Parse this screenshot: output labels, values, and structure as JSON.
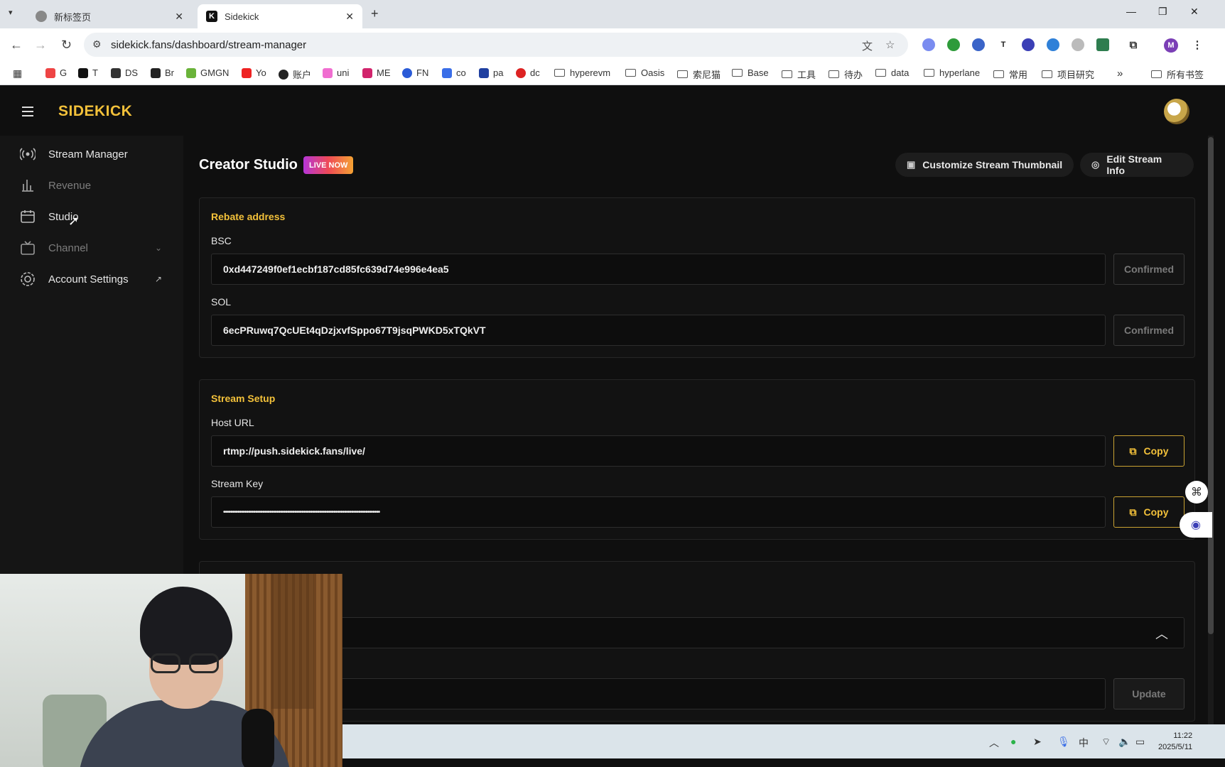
{
  "browser": {
    "tabs": [
      {
        "label": "新标签页",
        "active": false
      },
      {
        "label": "Sidekick",
        "active": true
      }
    ],
    "url": "sidekick.fans/dashboard/stream-manager",
    "profile_initial": "M",
    "bookmarks": [
      "G",
      "T",
      "DS",
      "Br",
      "GMGN",
      "Yo",
      "账户",
      "uni",
      "ME",
      "FN",
      "co",
      "pa",
      "dc"
    ],
    "bookmark_folders": [
      "hyperevm",
      "Oasis",
      "索尼猫",
      "Base",
      "工具",
      "待办",
      "data",
      "hyperlane",
      "常用",
      "项目研究"
    ],
    "all_bookmarks": "所有书签",
    "more": "»"
  },
  "app": {
    "logo": "SIDEKICK",
    "sidebar": {
      "items": [
        {
          "label": "Stream Manager",
          "icon": "broadcast-icon"
        },
        {
          "label": "Revenue",
          "icon": "bar-chart-icon"
        },
        {
          "label": "Studio",
          "icon": "calendar-icon"
        },
        {
          "label": "Channel",
          "icon": "tv-icon"
        },
        {
          "label": "Account Settings",
          "icon": "gear-icon"
        }
      ]
    },
    "header": {
      "title": "Creator Studio",
      "badge": "LIVE NOW",
      "customize_label": "Customize Stream Thumbnail",
      "edit_label": "Edit Stream Info"
    },
    "rebate": {
      "title": "Rebate address",
      "bsc_label": "BSC",
      "bsc_value": "0xd447249f0ef1ecbf187cd85fc639d74e996e4ea5",
      "bsc_status": "Confirmed",
      "sol_label": "SOL",
      "sol_value": "6ecPRuwq7QcUEt4qDzjxvfSppo67T9jsqPWKD5xTQkVT",
      "sol_status": "Confirmed"
    },
    "stream_setup": {
      "title": "Stream Setup",
      "host_label": "Host URL",
      "host_value": "rtmp://push.sidekick.fans/live/",
      "key_label": "Stream Key",
      "key_value": "••••••••••••••••••••••••••••••••••••••••••••••••••••••••••••••••••••••••••••••••••••••••",
      "copy_label": "Copy"
    },
    "third_card": {
      "update_label": "Update"
    }
  },
  "taskbar": {
    "ime": "中",
    "time": "11:22",
    "date": "2025/5/11"
  },
  "colors": {
    "accent": "#f3c13a",
    "background": "#0f0f0f"
  }
}
